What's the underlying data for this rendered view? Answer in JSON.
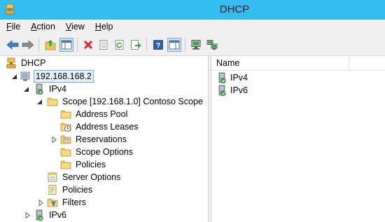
{
  "window": {
    "title": "DHCP"
  },
  "menu": [
    {
      "label": "File",
      "key": "F",
      "rest": "ile"
    },
    {
      "label": "Action",
      "key": "A",
      "rest": "ction"
    },
    {
      "label": "View",
      "key": "V",
      "rest": "iew"
    },
    {
      "label": "Help",
      "key": "H",
      "rest": "elp"
    }
  ],
  "toolbar": {
    "buttons": [
      "back-arrow-icon",
      "forward-arrow-icon",
      "up-folder-icon",
      "show-hide-console-tree-icon",
      "delete-icon",
      "properties-icon",
      "refresh-icon",
      "export-list-icon",
      "help-icon",
      "action-pane-icon",
      "server-connect-icon",
      "server-network-icon"
    ],
    "active": [
      "show-hide-console-tree-icon",
      "action-pane-icon"
    ]
  },
  "tree": {
    "root": "DHCP",
    "server": "192.168.168.2",
    "ipv4": "IPv4",
    "scope": "Scope [192.168.1.0] Contoso Scope",
    "address_pool": "Address Pool",
    "address_leases": "Address Leases",
    "reservations": "Reservations",
    "scope_options": "Scope Options",
    "scope_policies": "Policies",
    "server_options": "Server Options",
    "policies": "Policies",
    "filters": "Filters",
    "ipv6": "IPv6"
  },
  "list": {
    "column_name": "Name",
    "items": [
      "IPv4",
      "IPv6"
    ]
  },
  "colors": {
    "titlebar": "#33bdf1",
    "selection": "#e5f0fb",
    "selection_border": "#7da2ce"
  }
}
